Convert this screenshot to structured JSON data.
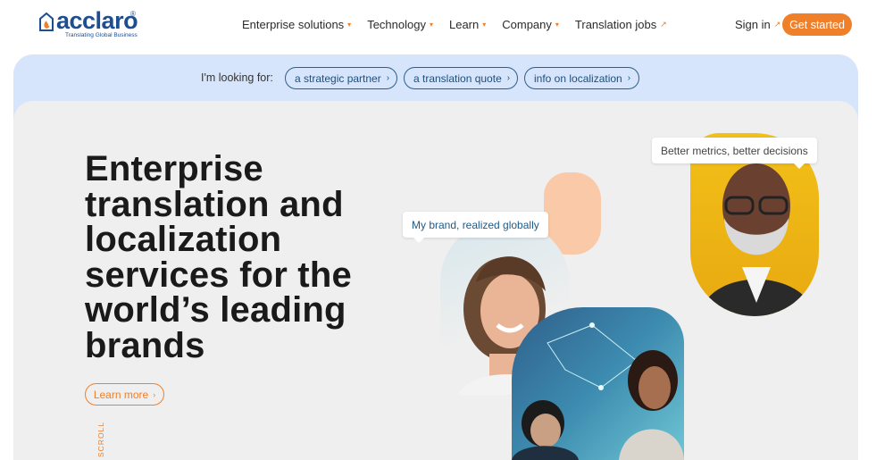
{
  "logo": {
    "name": "acclaro",
    "registered": "®",
    "tagline": "Translating Global Business"
  },
  "nav": {
    "items": [
      {
        "label": "Enterprise solutions",
        "indicator": "caret"
      },
      {
        "label": "Technology",
        "indicator": "caret"
      },
      {
        "label": "Learn",
        "indicator": "caret"
      },
      {
        "label": "Company",
        "indicator": "caret"
      },
      {
        "label": "Translation jobs",
        "indicator": "arrow"
      }
    ],
    "sign_in": "Sign in",
    "get_started": "Get started"
  },
  "looking_for": {
    "label": "I'm looking for:",
    "options": [
      "a strategic partner",
      "a translation quote",
      "info on localization"
    ]
  },
  "hero": {
    "headline": "Enterprise translation and localization services for the world’s leading brands",
    "learn_more": "Learn more",
    "scroll": "SCROLL",
    "bubble_brand": "My brand, realized globally",
    "bubble_metrics": "Better metrics, better decisions"
  },
  "colors": {
    "accent": "#f07f2a",
    "brand_blue": "#1d4e8f",
    "band_bg": "#d6e5fb",
    "hero_bg": "#efefef"
  }
}
